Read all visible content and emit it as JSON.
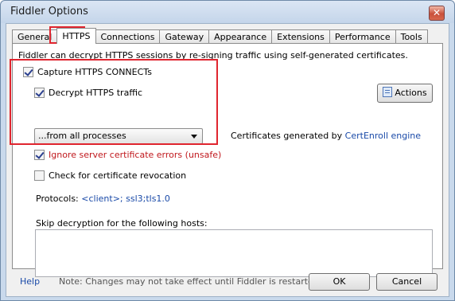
{
  "window": {
    "title": "Fiddler Options",
    "close_glyph": "✕"
  },
  "tabs": [
    {
      "label": "General",
      "active": false
    },
    {
      "label": "HTTPS",
      "active": true
    },
    {
      "label": "Connections",
      "active": false
    },
    {
      "label": "Gateway",
      "active": false
    },
    {
      "label": "Appearance",
      "active": false
    },
    {
      "label": "Extensions",
      "active": false
    },
    {
      "label": "Performance",
      "active": false
    },
    {
      "label": "Tools",
      "active": false
    }
  ],
  "https": {
    "description": "Fiddler can decrypt HTTPS sessions by re-signing traffic using self-generated certificates.",
    "capture_connects": {
      "label": "Capture HTTPS CONNECTs",
      "checked": true
    },
    "decrypt_traffic": {
      "label": "Decrypt HTTPS traffic",
      "checked": true
    },
    "process_filter": {
      "value": "...from all processes"
    },
    "ignore_errors": {
      "label": "Ignore server certificate errors (unsafe)",
      "checked": true
    },
    "check_revocation": {
      "label": "Check for certificate revocation",
      "checked": false
    },
    "certificates": {
      "prefix": "Certificates generated by ",
      "engine_link": "CertEnroll engine"
    },
    "actions_button": "Actions",
    "protocols": {
      "label": "Protocols: ",
      "value": "<client>; ssl3;tls1.0"
    },
    "skip_label": "Skip decryption for the following hosts:",
    "skip_hosts": ""
  },
  "footer": {
    "help_link": "Help",
    "note": "Note: Changes may not take effect until Fiddler is restarted.",
    "ok_button": "OK",
    "cancel_button": "Cancel"
  },
  "colors": {
    "highlight_box": "#e0252f",
    "link": "#1a4aa8",
    "danger_text": "#c0181d"
  }
}
